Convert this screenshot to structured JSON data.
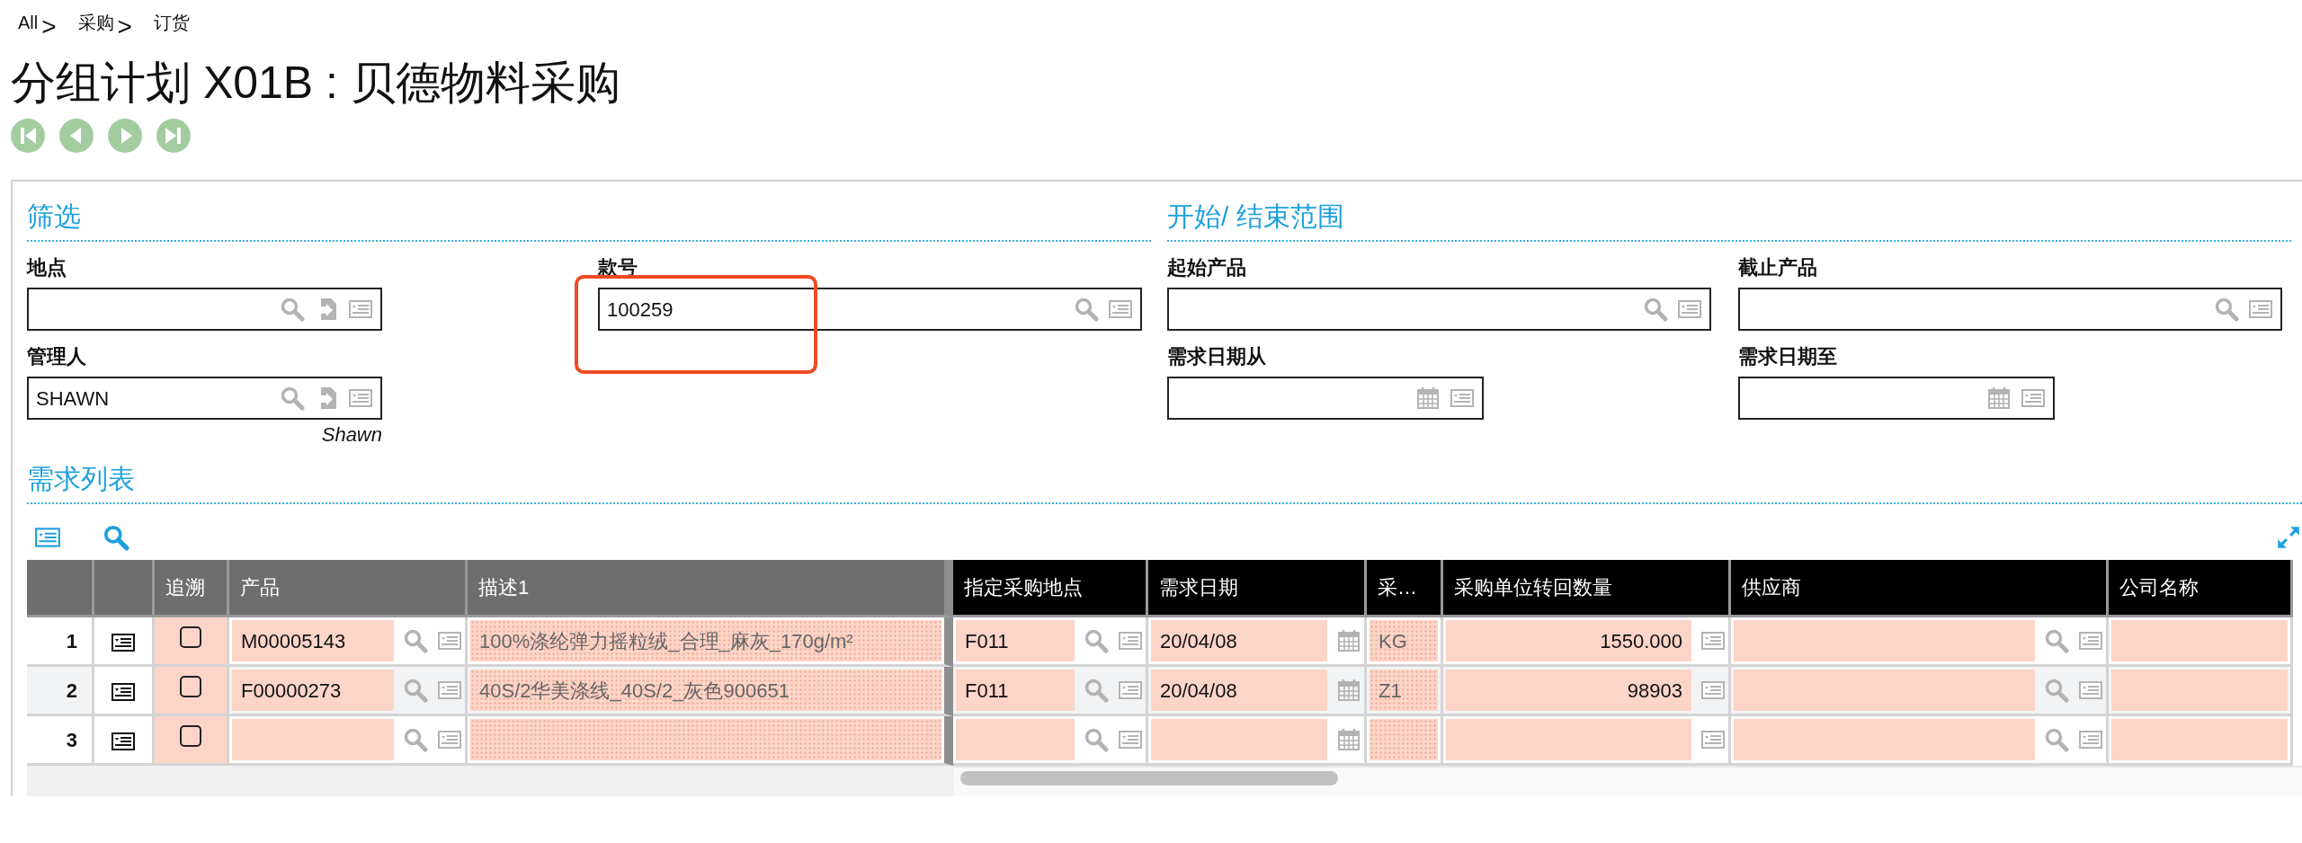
{
  "breadcrumb": [
    {
      "label": "All",
      "separator": ">"
    },
    {
      "label": "采购",
      "separator": ">"
    },
    {
      "label": "订货"
    }
  ],
  "title": "分组计划 X01B : 贝德物料采购",
  "nav_buttons": [
    {
      "kind": "first"
    },
    {
      "kind": "previous"
    },
    {
      "kind": "next"
    },
    {
      "kind": "last"
    }
  ],
  "filter_sections": [
    {
      "title": "筛选",
      "fields": [
        {
          "label": "地点",
          "kind": "lookup_import",
          "highlighted": false
        },
        {
          "label": "款号",
          "kind": "lookup",
          "value": "100259",
          "highlighted": true
        },
        {
          "label": "管理人",
          "kind": "lookup_import",
          "value": "SHAWN",
          "note": "Shawn",
          "highlighted": false
        }
      ]
    },
    {
      "title": "开始/ 结束范围",
      "fields": [
        {
          "label": "起始产品",
          "kind": "lookup",
          "highlighted": false
        },
        {
          "label": "截止产品",
          "kind": "lookup",
          "highlighted": false
        },
        {
          "label": "需求日期从",
          "kind": "date",
          "highlighted": false
        },
        {
          "label": "需求日期至",
          "kind": "date",
          "highlighted": false
        }
      ]
    }
  ],
  "list_section": {
    "title": "需求列表",
    "columns": [
      {
        "kind": "index",
        "frozen": true
      },
      {
        "kind": "detail",
        "frozen": true
      },
      {
        "label": "追溯",
        "kind": "check",
        "frozen": true
      },
      {
        "label": "产品",
        "kind": "lookup",
        "frozen": true
      },
      {
        "label": "描述1",
        "kind": "readonly",
        "frozen": true
      },
      {
        "label": "指定采购地点",
        "kind": "lookup",
        "frozen": false
      },
      {
        "label": "需求日期",
        "kind": "date",
        "frozen": false
      },
      {
        "label": "采…",
        "kind": "readonly",
        "frozen": false
      },
      {
        "label": "采购单位转回数量",
        "kind": "number",
        "frozen": false
      },
      {
        "label": "供应商",
        "kind": "lookup",
        "frozen": false
      },
      {
        "label": "公司名称",
        "kind": "text",
        "frozen": false
      }
    ],
    "rows": [
      {
        "traced": false,
        "cells": [
          "1",
          "",
          "",
          "M00005143",
          "100%涤纶弹力摇粒绒_合理_麻灰_170g/m²",
          "F011",
          "20/04/08",
          "KG",
          "1550.000",
          "",
          ""
        ]
      },
      {
        "traced": false,
        "cells": [
          "2",
          "",
          "",
          "F00000273",
          "40S/2华美涤线_40S/2_灰色900651",
          "F011",
          "20/04/08",
          "Z1",
          "98903",
          "",
          ""
        ]
      },
      {
        "traced": false,
        "cells": [
          "3",
          "",
          "",
          "",
          "",
          "",
          "",
          "",
          "",
          "",
          ""
        ]
      }
    ]
  }
}
